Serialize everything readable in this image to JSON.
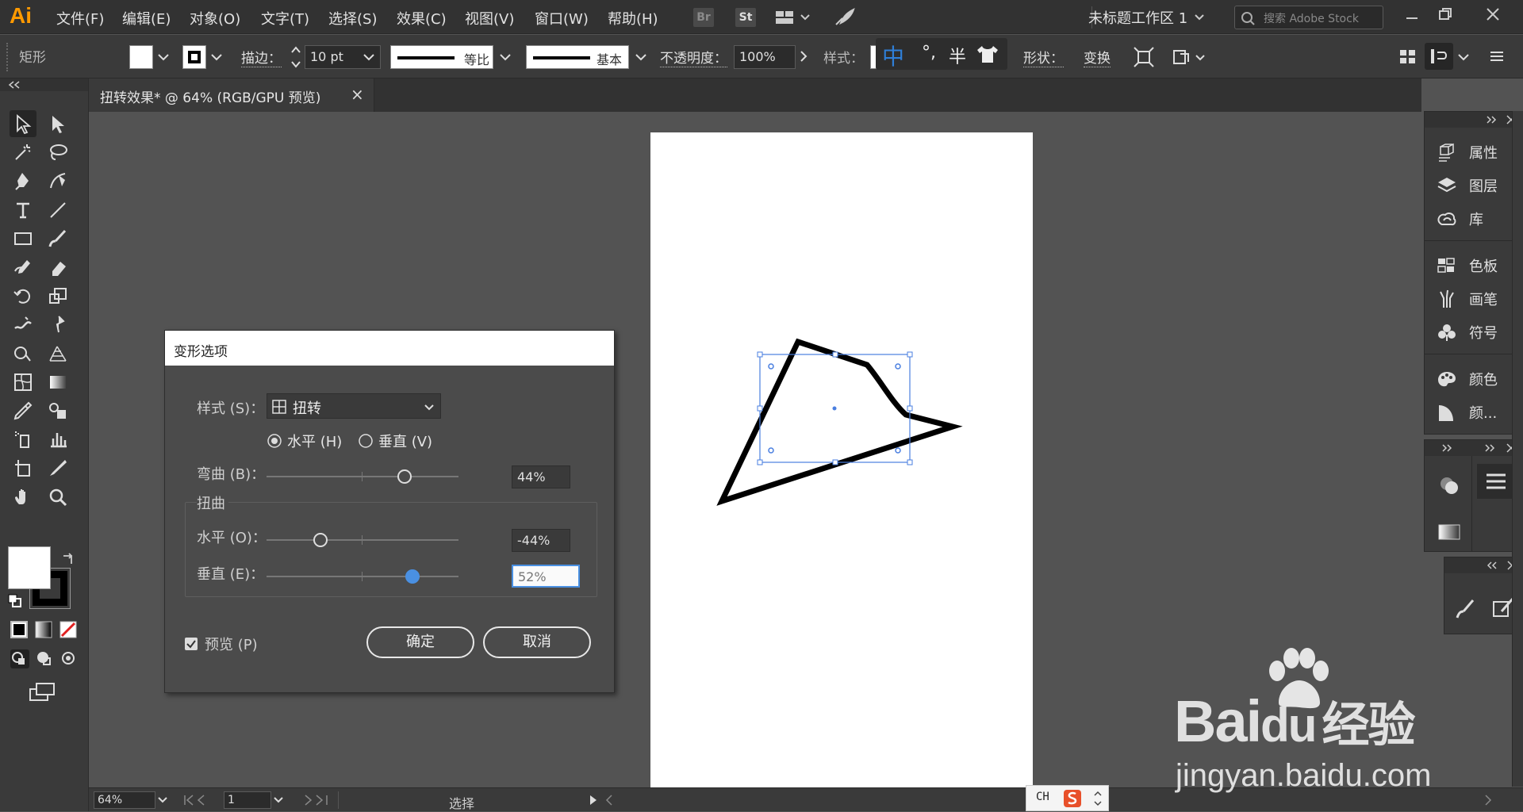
{
  "app": {
    "logo": "Ai",
    "workspace": "未标题工作区 1",
    "search_placeholder": "搜索 Adobe Stock",
    "bridge": "Br",
    "stock": "St"
  },
  "menu": [
    "文件(F)",
    "编辑(E)",
    "对象(O)",
    "文字(T)",
    "选择(S)",
    "效果(C)",
    "视图(V)",
    "窗口(W)",
    "帮助(H)"
  ],
  "control_bar": {
    "object_type": "矩形",
    "stroke_label": "描边：",
    "stroke_weight": "10 pt",
    "profile_label": "等比",
    "brush_label": "基本",
    "opacity_label": "不透明度：",
    "opacity_value": "100%",
    "style_label": "样式：",
    "shape_label": "形状：",
    "transform_label": "变换"
  },
  "ime": {
    "mode": "中",
    "punct": "°,",
    "width": "半"
  },
  "tab": {
    "title": "扭转效果* @ 64% (RGB/GPU 预览)",
    "close": "×"
  },
  "panels": {
    "group1": [
      "属性",
      "图层",
      "库"
    ],
    "group2": [
      "色板",
      "画笔",
      "符号"
    ],
    "group3": [
      "颜色",
      "颜..."
    ]
  },
  "dialog": {
    "title": "变形选项",
    "style_label": "样式 (S)：",
    "style_value": "扭转",
    "horizontal_radio": "水平 (H)",
    "vertical_radio": "垂直 (V)",
    "orientation_selected": "horizontal",
    "bend_label": "弯曲 (B)：",
    "bend_value": "44%",
    "distortion_group": "扭曲",
    "h_label": "水平 (O)：",
    "h_value": "-44%",
    "v_label": "垂直 (E)：",
    "v_value": "52%",
    "preview_label": "预览 (P)",
    "preview_checked": true,
    "ok": "确定",
    "cancel": "取消",
    "bend_percent": 44,
    "h_percent": -44,
    "v_percent": 52
  },
  "status": {
    "zoom": "64%",
    "artboard": "1",
    "tool": "选择",
    "ime_lang": "CH"
  },
  "watermark": {
    "brand": "Bai",
    "brand2": "du",
    "suffix": "经验",
    "url": "jingyan.baidu.com"
  },
  "colors": {
    "accent": "#4a90e2",
    "brand_orange": "#ff9a00",
    "selection": "#4a7fe0"
  }
}
